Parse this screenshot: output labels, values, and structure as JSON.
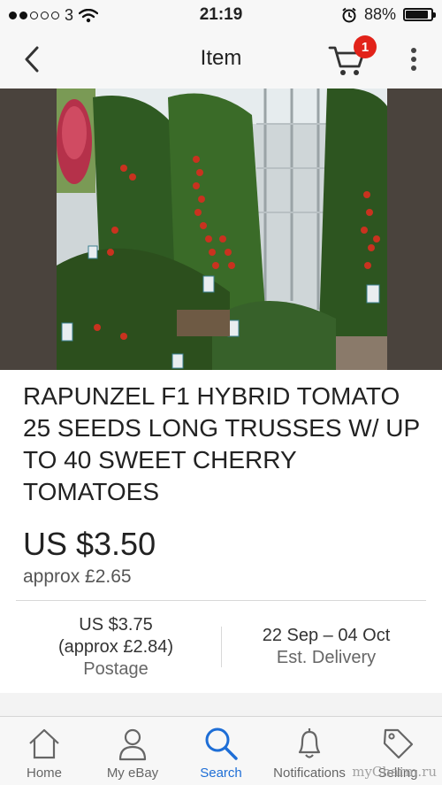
{
  "status_bar": {
    "carrier": "3",
    "time": "21:19",
    "battery": "88%",
    "battery_level": 0.88
  },
  "nav": {
    "title": "Item",
    "cart_count": "1"
  },
  "product": {
    "title": "RAPUNZEL F1 HYBRID TOMATO 25 SEEDS LONG TRUSSES W/ UP TO 40 SWEET CHERRY TOMATOES",
    "price": "US $3.50",
    "price_approx": "approx £2.65",
    "postage_price": "US $3.75",
    "postage_approx": "(approx £2.84)",
    "postage_label": "Postage",
    "delivery_dates": "22 Sep – 04 Oct",
    "delivery_label": "Est. Delivery"
  },
  "tabs": [
    {
      "label": "Home",
      "icon": "home-icon"
    },
    {
      "label": "My eBay",
      "icon": "person-icon"
    },
    {
      "label": "Search",
      "icon": "search-icon",
      "active": true
    },
    {
      "label": "Notifications",
      "icon": "bell-icon"
    },
    {
      "label": "Selling",
      "icon": "tag-icon"
    }
  ],
  "watermark": "myCharm.ru",
  "colors": {
    "accent": "#1e6ed6",
    "badge": "#e2231a",
    "bar_bg": "#f7f7f7"
  }
}
